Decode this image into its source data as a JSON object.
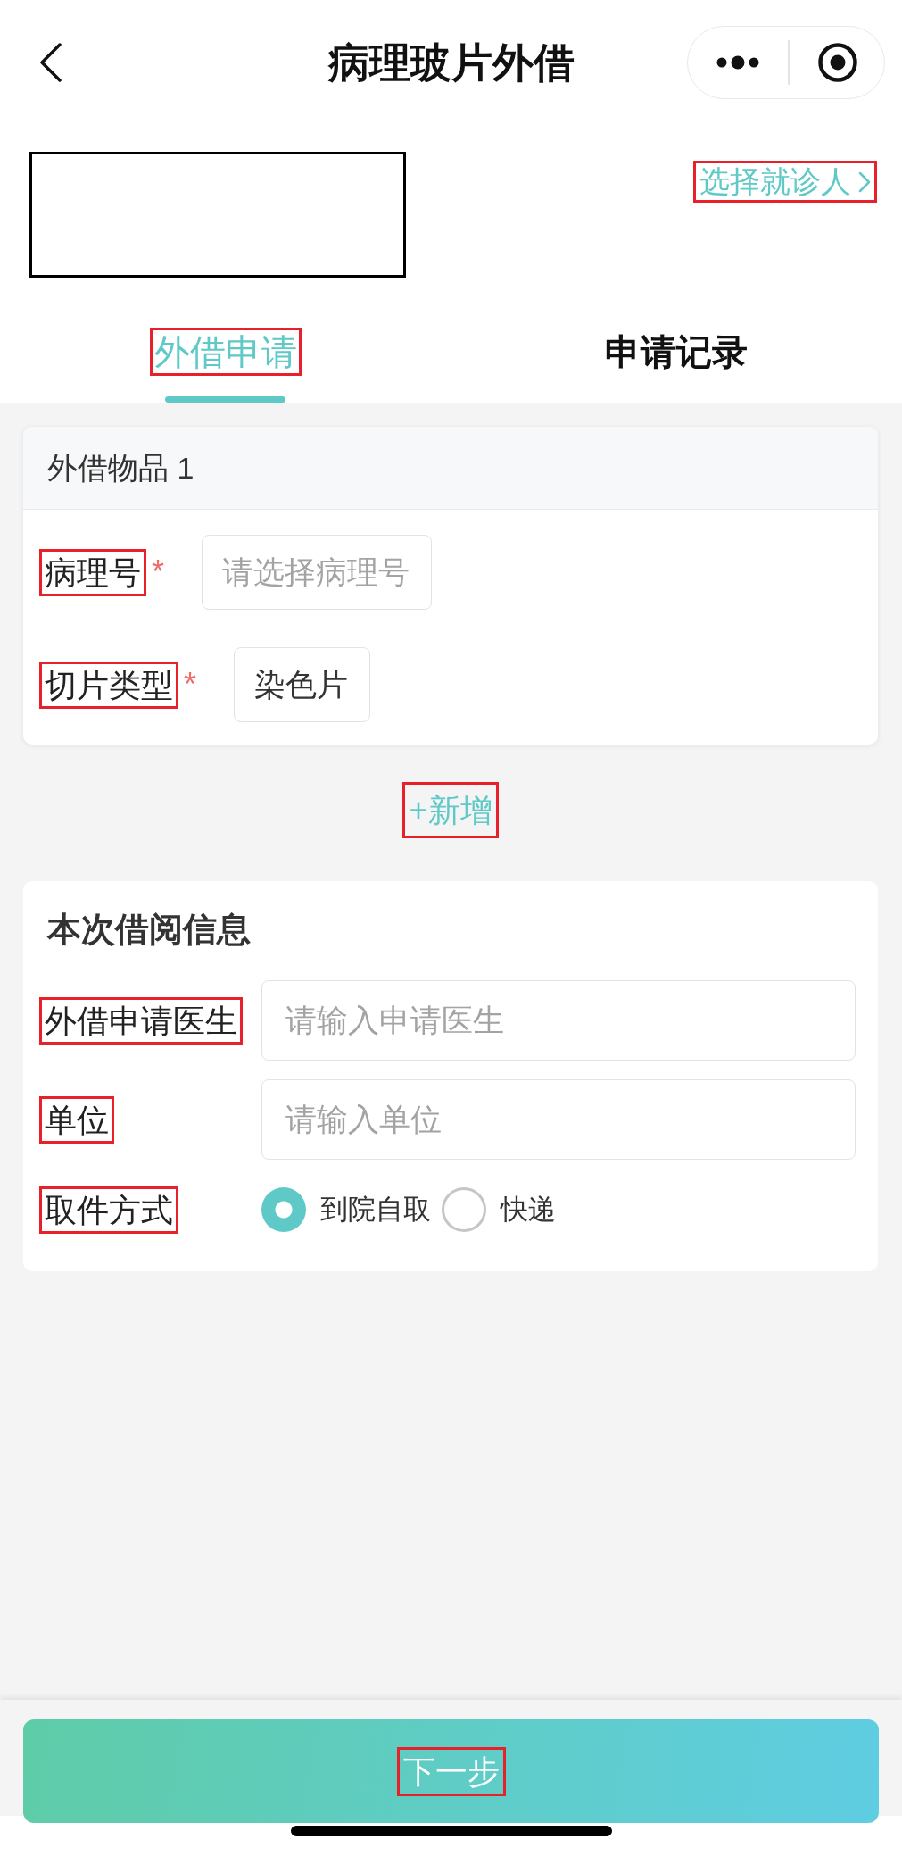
{
  "nav_bar": {
    "title": "病理玻片外借"
  },
  "patient": {
    "select_link": {
      "label": "选择就诊人",
      "highlighted": true
    }
  },
  "tabs": [
    {
      "label": "外借申请",
      "selected": true,
      "highlighted": true
    },
    {
      "label": "申请记录",
      "selected": false,
      "highlighted": false
    }
  ],
  "items": [
    {
      "title": "外借物品 1",
      "fields": [
        {
          "label": "病理号",
          "required_mark": "*",
          "placeholder": "请选择病理号",
          "highlighted": true
        },
        {
          "label": "切片类型",
          "required_mark": "*",
          "value": "染色片",
          "highlighted": true
        }
      ]
    }
  ],
  "add_button": {
    "label": "+新增",
    "highlighted": true
  },
  "borrow_info": {
    "title": "本次借阅信息",
    "fields": [
      {
        "kind": "input",
        "label": "外借申请医生",
        "placeholder": "请输入申请医生",
        "highlighted": true
      },
      {
        "kind": "input",
        "label": "单位",
        "placeholder": "请输入单位",
        "highlighted": true
      },
      {
        "kind": "radio",
        "label": "取件方式",
        "highlighted": true,
        "options": [
          {
            "label": "到院自取",
            "selected": true
          },
          {
            "label": "快递",
            "selected": false
          }
        ]
      }
    ]
  },
  "next_button": {
    "label": "下一步",
    "highlighted": true
  }
}
